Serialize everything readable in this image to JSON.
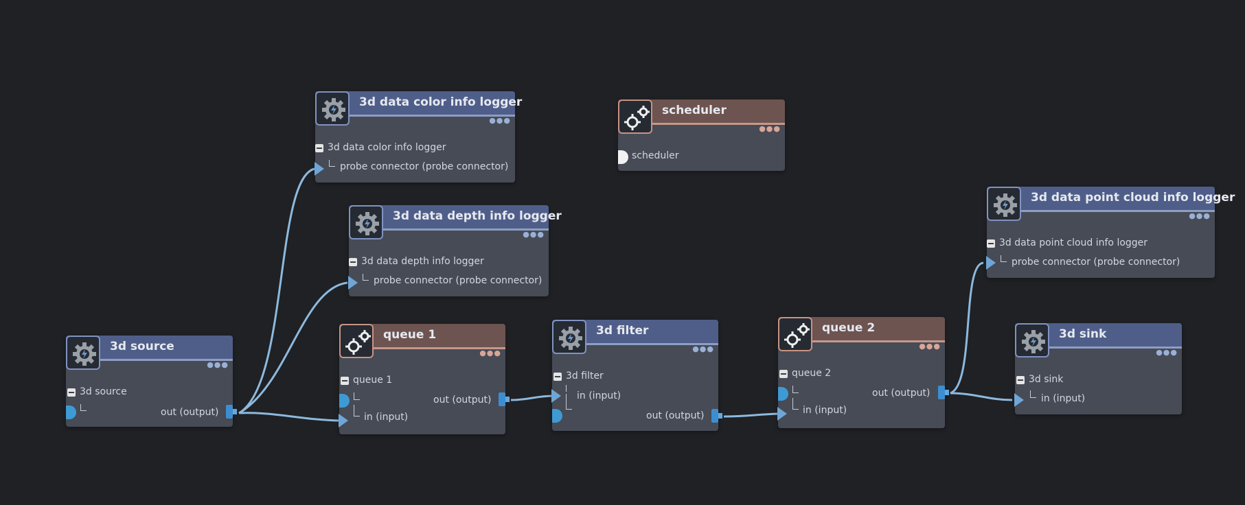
{
  "colors": {
    "background": "#1f2124",
    "node_body": "#464b56",
    "header_blue": "#4f5e89",
    "header_brown": "#6d5450",
    "wire": "#8eb9de",
    "port": "#3d8ed0"
  },
  "nodes": {
    "color_logger": {
      "title": "3d data color info logger",
      "icon": "gear-bolt-icon",
      "group": "3d data color info logger",
      "port_in": "probe connector (probe connector)"
    },
    "depth_logger": {
      "title": "3d data depth info logger",
      "icon": "gear-bolt-icon",
      "group": "3d data depth info logger",
      "port_in": "probe connector (probe connector)"
    },
    "scheduler": {
      "title": "scheduler",
      "icon": "gears-icon",
      "port": "scheduler"
    },
    "pointcloud_logger": {
      "title": "3d data point cloud info logger",
      "icon": "gear-bolt-icon",
      "group": "3d data point cloud info logger",
      "port_in": "probe connector (probe connector)"
    },
    "source": {
      "title": "3d source",
      "icon": "gear-bolt-icon",
      "group": "3d source",
      "port_out": "out (output)"
    },
    "queue1": {
      "title": "queue 1",
      "icon": "gears-icon",
      "group": "queue 1",
      "port_out": "out (output)",
      "port_in": "in (input)"
    },
    "filter": {
      "title": "3d filter",
      "icon": "gear-bolt-icon",
      "group": "3d filter",
      "port_in": "in (input)",
      "port_out": "out (output)"
    },
    "queue2": {
      "title": "queue 2",
      "icon": "gears-icon",
      "group": "queue 2",
      "port_out": "out (output)",
      "port_in": "in (input)"
    },
    "sink": {
      "title": "3d sink",
      "icon": "gear-bolt-icon",
      "group": "3d sink",
      "port_in": "in (input)"
    }
  }
}
